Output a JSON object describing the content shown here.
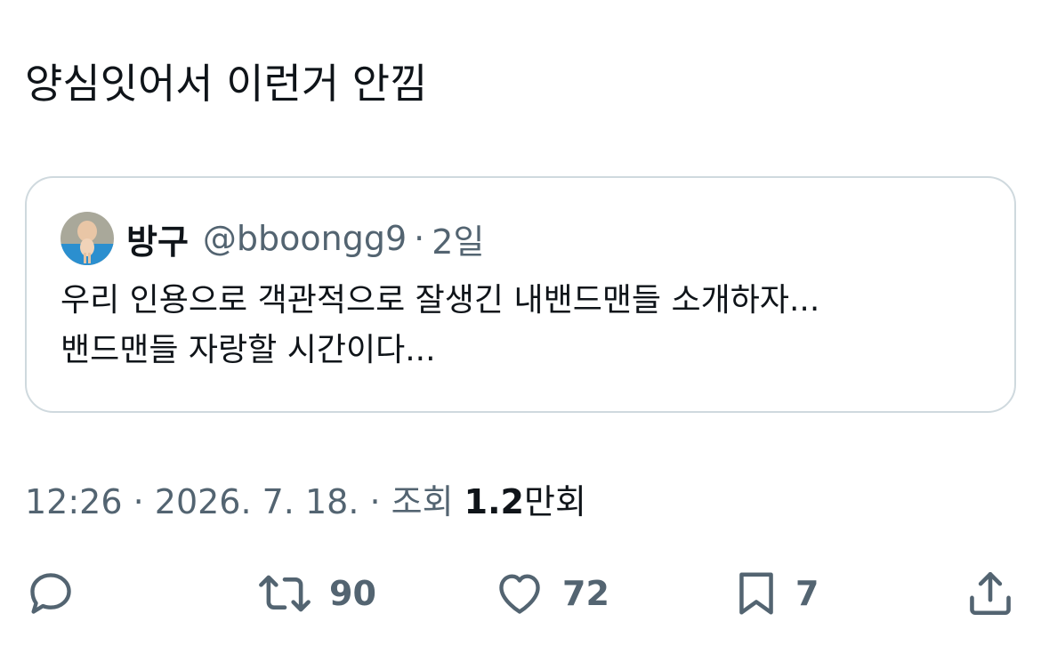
{
  "tweet": {
    "text": "양심잇어서 이런거 안낌"
  },
  "quote": {
    "name": "방구",
    "handle": "@bboongg9",
    "separator": "·",
    "time": "2일",
    "body_line1": "우리 인용으로 객관적으로 잘생긴 내밴드맨들 소개하자...",
    "body_line2": "밴드맨들 자랑할 시간이다..."
  },
  "meta": {
    "time": "12:26",
    "sep1": " · ",
    "date": "2026. 7. 18.",
    "sep2": " · ",
    "views_label": "조회",
    "views_count": "1.2",
    "views_unit": "만회"
  },
  "actions": {
    "reply_icon": "reply-icon",
    "retweet_icon": "retweet-icon",
    "retweet_count": "90",
    "like_icon": "heart-icon",
    "like_count": "72",
    "bookmark_icon": "bookmark-icon",
    "bookmark_count": "7",
    "share_icon": "share-icon"
  },
  "colors": {
    "text": "#0f1419",
    "secondary": "#536471",
    "border": "#cfd9de"
  }
}
